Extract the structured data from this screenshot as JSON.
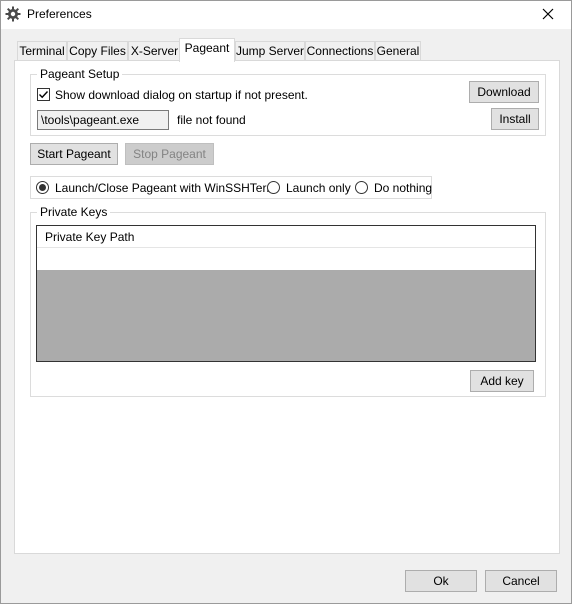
{
  "window": {
    "title": "Preferences"
  },
  "tabs": [
    {
      "label": "Terminal",
      "active": false
    },
    {
      "label": "Copy Files",
      "active": false
    },
    {
      "label": "X-Server",
      "active": false
    },
    {
      "label": "Pageant",
      "active": true
    },
    {
      "label": "Jump Server",
      "active": false
    },
    {
      "label": "Connections",
      "active": false
    },
    {
      "label": "General",
      "active": false
    }
  ],
  "pageant_setup": {
    "group_label": "Pageant Setup",
    "show_download_checkbox": {
      "label": "Show download dialog on startup if not present.",
      "checked": true
    },
    "download_button": "Download",
    "path_value": "\\tools\\pageant.exe",
    "status": "file not found",
    "install_button": "Install"
  },
  "controls": {
    "start_button": "Start Pageant",
    "stop_button": "Stop Pageant",
    "stop_disabled": true
  },
  "launch_options": [
    {
      "label": "Launch/Close Pageant with WinSSHTerm",
      "selected": true
    },
    {
      "label": "Launch only",
      "selected": false
    },
    {
      "label": "Do nothing",
      "selected": false
    }
  ],
  "private_keys": {
    "group_label": "Private Keys",
    "column_header": "Private Key Path",
    "add_button": "Add key"
  },
  "footer": {
    "ok_button": "Ok",
    "cancel_button": "Cancel"
  },
  "icons": {
    "app": "gear-icon",
    "close": "close-icon",
    "check": "checkmark-icon"
  }
}
